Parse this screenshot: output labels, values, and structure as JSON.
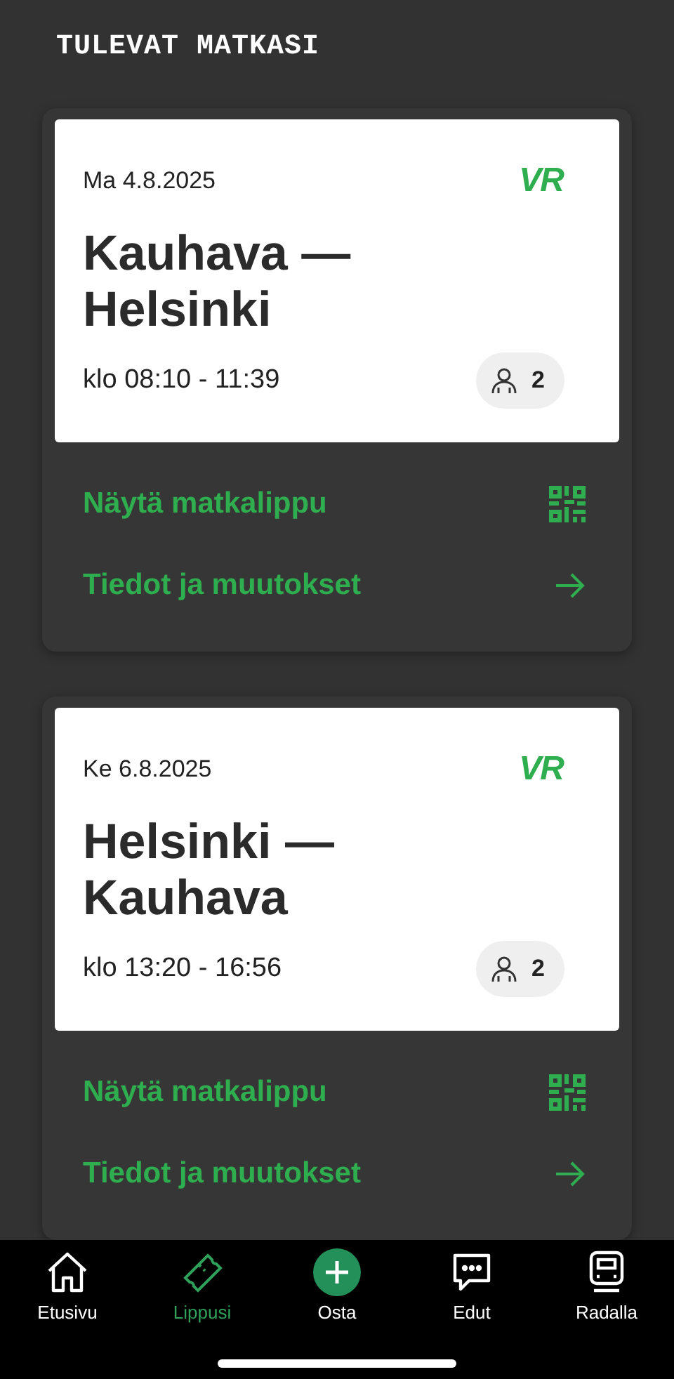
{
  "heading": "TULEVAT MATKASI",
  "trips": [
    {
      "date": "Ma 4.8.2025",
      "logo": "VR",
      "route": "Kauhava — Helsinki",
      "time": "klo 08:10 - 11:39",
      "passengers": "2",
      "actions": [
        {
          "kind": "ticket",
          "label": "Näytä matkalippu"
        },
        {
          "kind": "details",
          "label": "Tiedot ja muutokset"
        }
      ]
    },
    {
      "date": "Ke 6.8.2025",
      "logo": "VR",
      "route": "Helsinki — Kauhava",
      "time": "klo 13:20 - 16:56",
      "passengers": "2",
      "actions": [
        {
          "kind": "ticket",
          "label": "Näytä matkalippu"
        },
        {
          "kind": "details",
          "label": "Tiedot ja muutokset"
        }
      ]
    }
  ],
  "nav": [
    {
      "kind": "home",
      "label": "Etusivu",
      "selected": false
    },
    {
      "kind": "ticket",
      "label": "Lippusi",
      "selected": true
    },
    {
      "kind": "buy",
      "label": "Osta",
      "selected": false
    },
    {
      "kind": "chat",
      "label": "Edut",
      "selected": false
    },
    {
      "kind": "train",
      "label": "Radalla",
      "selected": false
    }
  ]
}
